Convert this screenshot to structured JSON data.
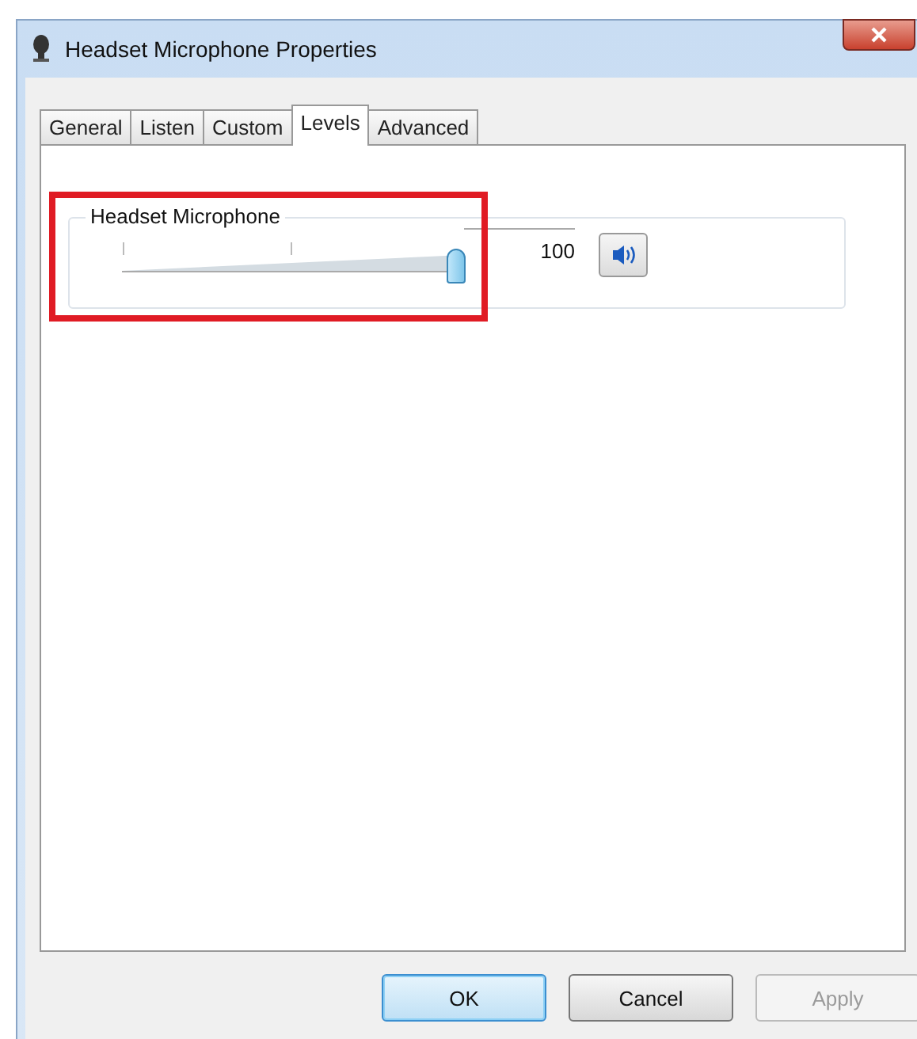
{
  "window": {
    "title": "Headset Microphone Properties"
  },
  "tabs": [
    {
      "label": "General",
      "selected": false
    },
    {
      "label": "Listen",
      "selected": false
    },
    {
      "label": "Custom",
      "selected": false
    },
    {
      "label": "Levels",
      "selected": true
    },
    {
      "label": "Advanced",
      "selected": false
    }
  ],
  "level_group": {
    "label": "Headset Microphone",
    "level": 1,
    "reading": "100",
    "muted": false,
    "highlighted": true
  },
  "buttons": [
    {
      "label": "OK",
      "default": true,
      "disabled": false
    },
    {
      "label": "Cancel",
      "default": false,
      "disabled": false
    },
    {
      "label": "Apply",
      "default": false,
      "disabled": true
    }
  ]
}
